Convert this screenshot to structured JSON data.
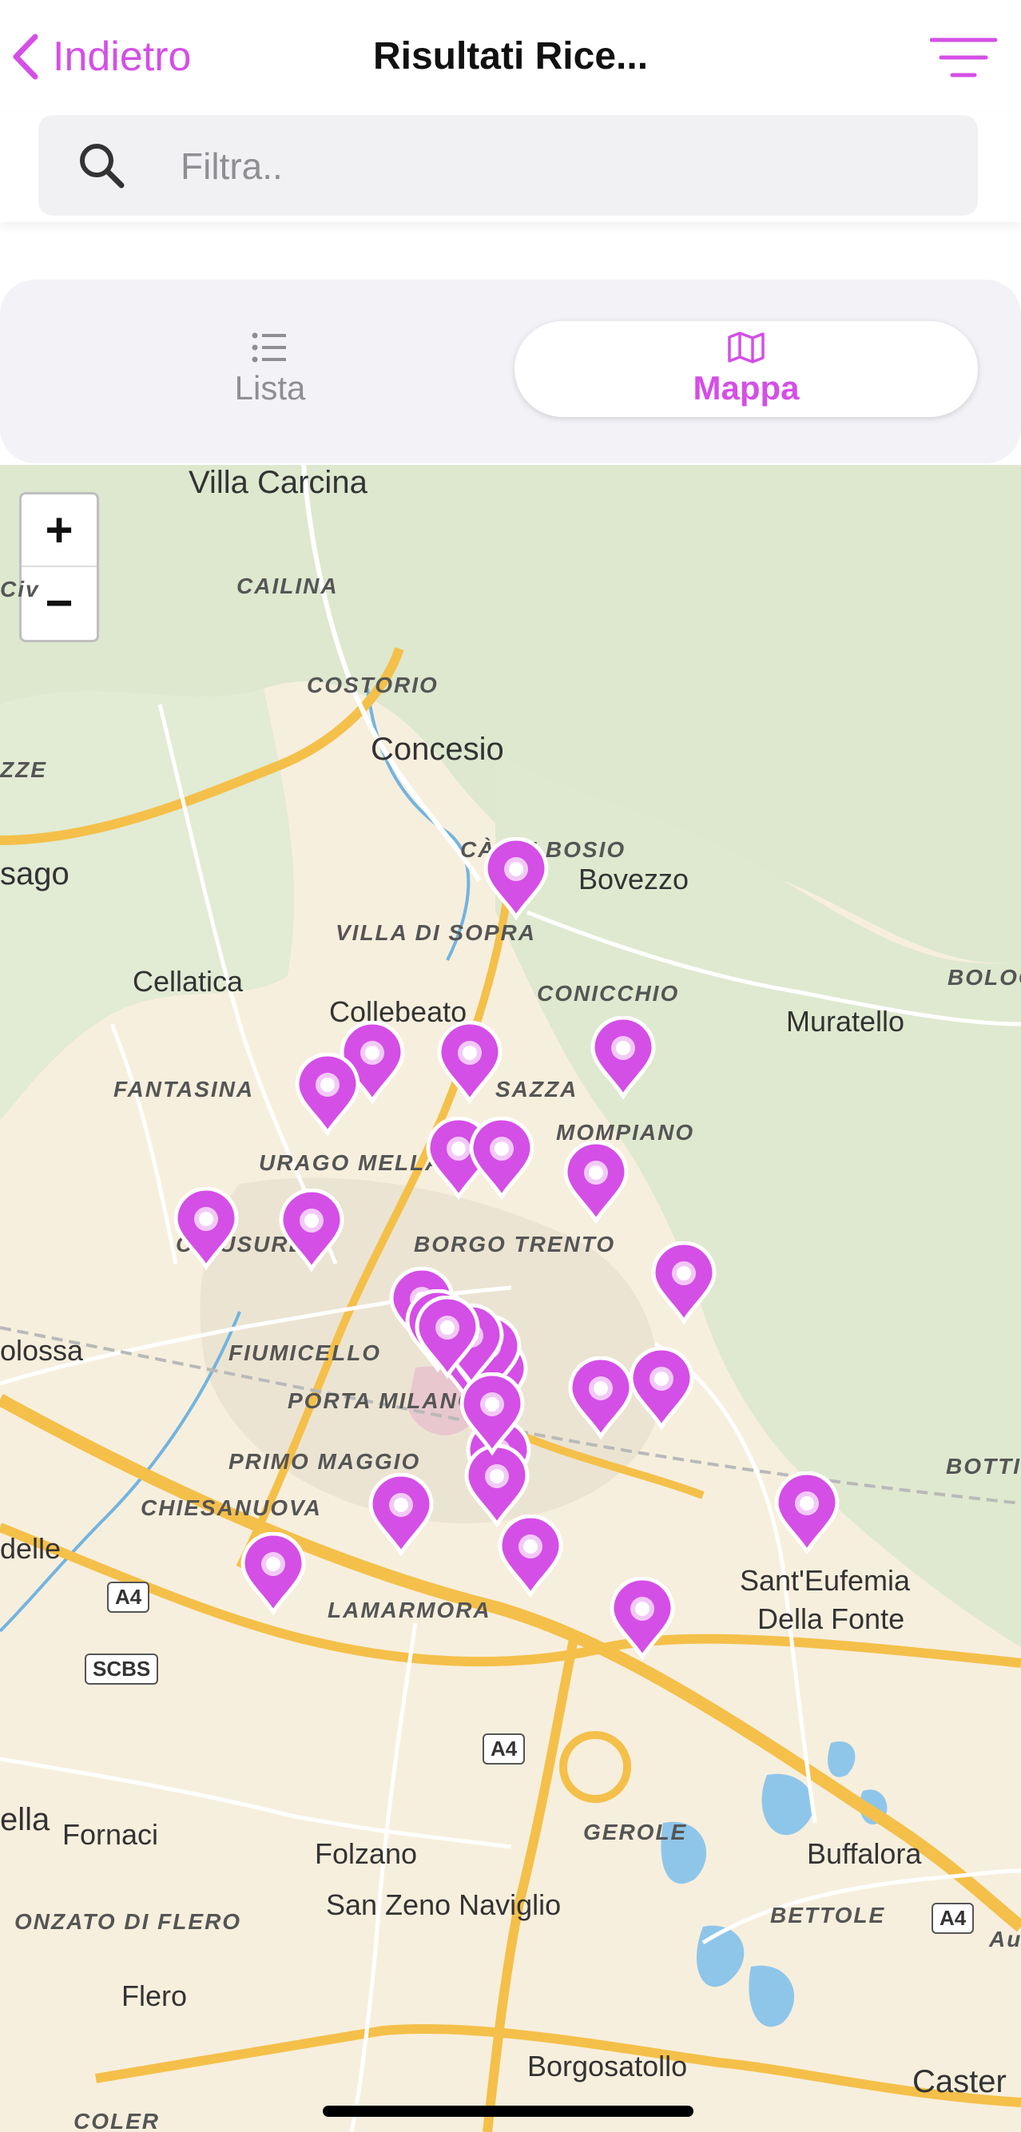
{
  "nav": {
    "back_label": "Indietro",
    "title": "Risultati Rice...",
    "filter_icon": "filter-lines-icon"
  },
  "search": {
    "placeholder": "Filtra.."
  },
  "tabs": [
    {
      "label": "Lista",
      "icon": "list-icon",
      "selected": false
    },
    {
      "label": "Mappa",
      "icon": "map-icon",
      "selected": true
    }
  ],
  "map": {
    "zoom_in": "+",
    "zoom_out": "−",
    "places": {
      "villa_carcina": "Villa Carcina",
      "cailina": "CAILINA",
      "costorio": "COSTORIO",
      "concesio": "Concesio",
      "ca_de_bosio": "CÀ DE BOSIO",
      "bovezzo": "Bovezzo",
      "sago": "sago",
      "villa_di_sopra": "VILLA DI SOPRA",
      "cellatica": "Cellatica",
      "collebeato": "Collebeato",
      "conicchio": "CONICCHIO",
      "bolog": "BOLOG",
      "muratello": "Muratello",
      "fantasina": "FANTASINA",
      "sazza": "SAZZA",
      "mompiano": "MOMPIANO",
      "urago_mella": "URAGO MELLA",
      "chiusure": "CHIUSURE",
      "borgo_trento": "BORGO TRENTO",
      "civ": "Civ",
      "zze": "ZZE",
      "olossa": "olossa",
      "fiumicello": "FIUMICELLO",
      "porta_milano": "PORTA MILANO",
      "primo_maggio": "PRIMO MAGGIO",
      "bottic": "BOTTIC",
      "chiesanuova": "CHIESANUOVA",
      "delle": "delle",
      "sant_eufemia": "Sant'Eufemia",
      "della_fonte": "Della Fonte",
      "lamarmora": "LAMARMORA",
      "ella": "ella",
      "fornaci": "Fornaci",
      "folzano": "Folzano",
      "gerole": "GEROLE",
      "buffalora": "Buffalora",
      "san_zeno": "San Zeno Naviglio",
      "onzato": "ONZATO DI FLERO",
      "bettole": "BETTOLE",
      "flero": "Flero",
      "borgosatollo": "Borgosatollo",
      "caster": "Caster",
      "coler": "COLER",
      "au": "Au"
    },
    "shields": {
      "a4_left": "A4",
      "scbs": "SCBS",
      "a4_mid": "A4",
      "a4_right": "A4"
    },
    "pin_color": "#d44fe6",
    "pin_count": 30
  },
  "colors": {
    "accent": "#d44fe6"
  }
}
